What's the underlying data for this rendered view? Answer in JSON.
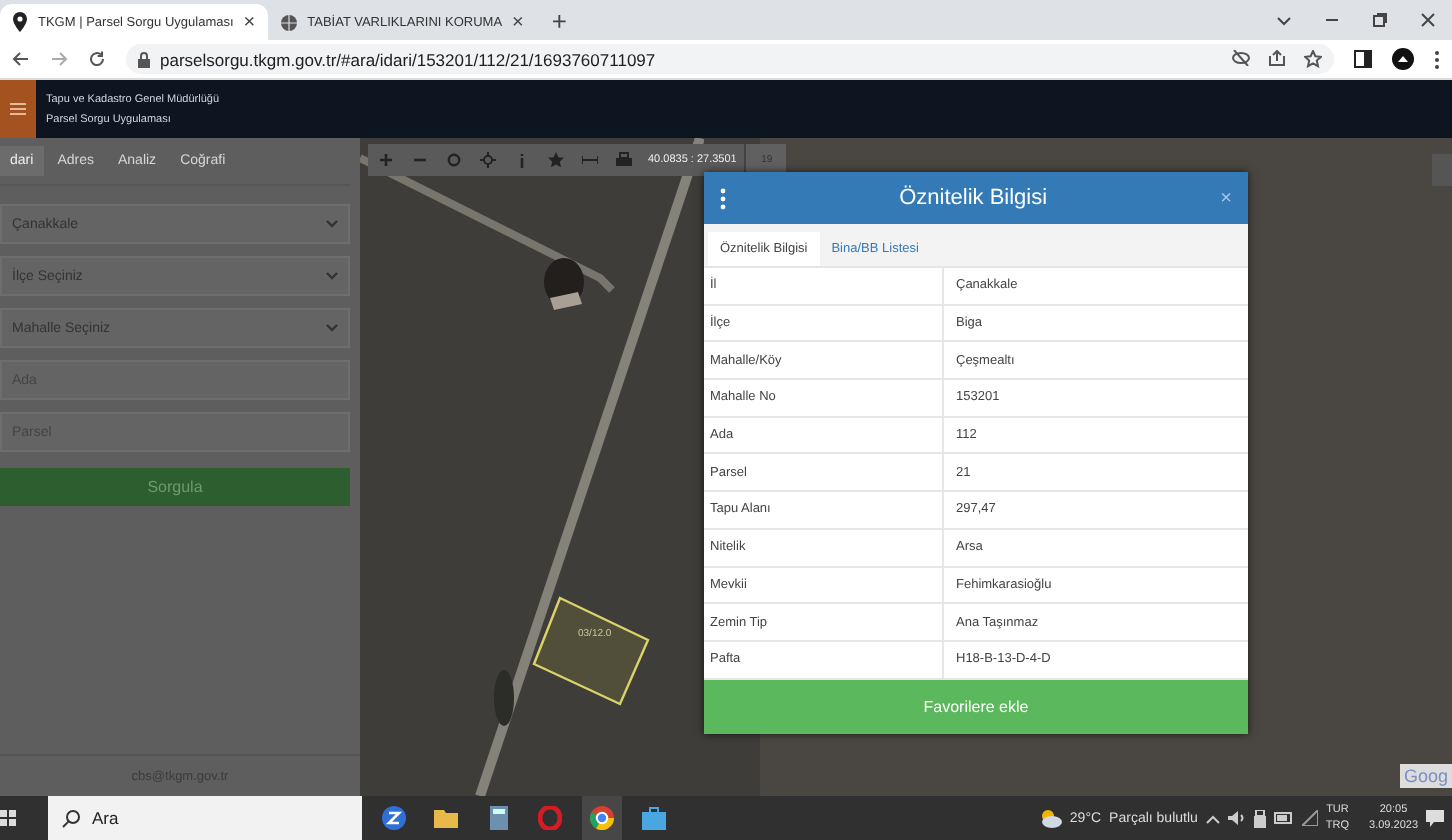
{
  "browser": {
    "tabs": [
      {
        "title": "TKGM | Parsel Sorgu Uygulaması",
        "close": "×",
        "selected": true
      },
      {
        "title": "TABİAT VARLIKLARINI KORUMA",
        "close": "×",
        "selected": false
      }
    ],
    "new_tab": "+",
    "url": "parselsorgu.tkgm.gov.tr/#ara/idari/153201/112/21/1693760711097"
  },
  "app_header": {
    "lines": [
      "Tapu ve Kadastro Genel Müdürlüğü",
      "Parsel Sorgu Uygulaması"
    ]
  },
  "sidebar": {
    "tabs": [
      {
        "label": "dari",
        "selected": true
      },
      {
        "label": "Adres",
        "selected": false
      },
      {
        "label": "Analiz",
        "selected": false
      },
      {
        "label": "Coğrafi",
        "selected": false
      }
    ],
    "selects": [
      "Çanakkale",
      "İlçe Seçiniz",
      "Mahalle Seçiniz"
    ],
    "inputs": [
      {
        "placeholder": "Ada"
      },
      {
        "placeholder": "Parsel"
      }
    ],
    "button": "Sorgula",
    "footer": "cbs@tkgm.gov.tr"
  },
  "map": {
    "coordinates": "40.0835 : 27.3501",
    "zoom": "19",
    "parcel_label": "03/12.0",
    "attribution": "Goog"
  },
  "dialog": {
    "title": "Öznitelik Bilgisi",
    "close": "×",
    "tabs": [
      {
        "label": "Öznitelik Bilgisi",
        "selected": true
      },
      {
        "label": "Bina/BB Listesi",
        "selected": false
      }
    ],
    "rows": [
      {
        "label": "İl",
        "value": "Çanakkale"
      },
      {
        "label": "İlçe",
        "value": "Biga"
      },
      {
        "label": "Mahalle/Köy",
        "value": "Çeşmealtı"
      },
      {
        "label": "Mahalle No",
        "value": "153201"
      },
      {
        "label": "Ada",
        "value": "112"
      },
      {
        "label": "Parsel",
        "value": "21"
      },
      {
        "label": "Tapu Alanı",
        "value": "297,47"
      },
      {
        "label": "Nitelik",
        "value": "Arsa"
      },
      {
        "label": "Mevkii",
        "value": "Fehimkarasioğlu"
      },
      {
        "label": "Zemin Tip",
        "value": "Ana Taşınmaz"
      },
      {
        "label": "Pafta",
        "value": "H18-B-13-D-4-D"
      }
    ],
    "button": "Favorilere ekle"
  },
  "taskbar": {
    "search_placeholder": "Ara",
    "temperature": "29°C",
    "weather": "Parçalı bulutlu",
    "language": [
      "TUR",
      "TRQ"
    ],
    "time": "20:05",
    "date": "3.09.2023"
  }
}
